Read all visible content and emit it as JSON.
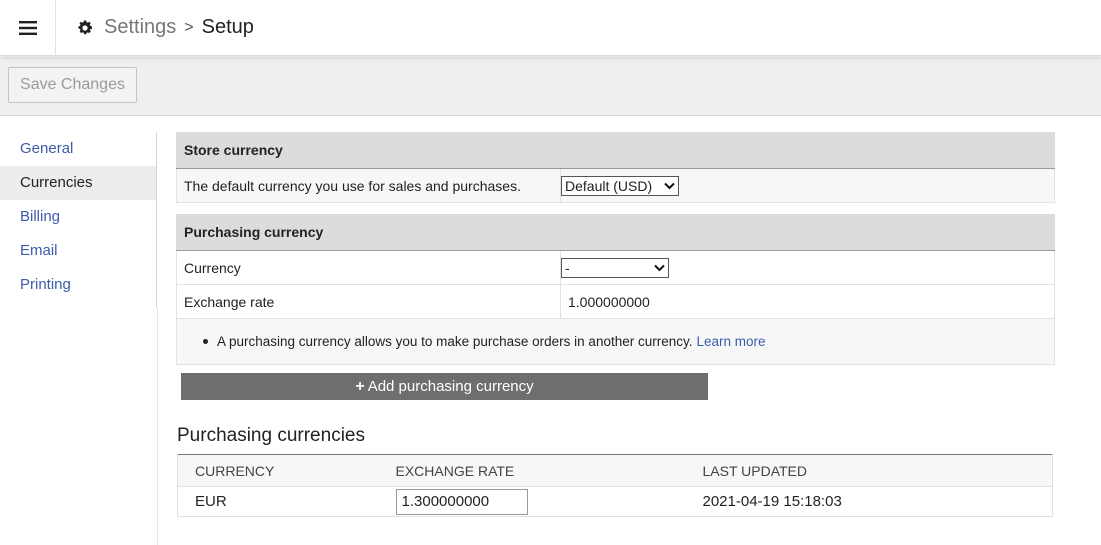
{
  "header": {
    "icon_menu": "hamburger-icon",
    "icon_settings": "gear-icon",
    "breadcrumb_parent": "Settings",
    "breadcrumb_separator": ">",
    "breadcrumb_current": "Setup"
  },
  "toolbar": {
    "save_label": "Save Changes"
  },
  "sidebar": {
    "items": [
      {
        "label": "General",
        "active": false
      },
      {
        "label": "Currencies",
        "active": true
      },
      {
        "label": "Billing",
        "active": false
      },
      {
        "label": "Email",
        "active": false
      },
      {
        "label": "Printing",
        "active": false
      }
    ]
  },
  "store_currency": {
    "heading": "Store currency",
    "description": "The default currency you use for sales and purchases.",
    "selected": "Default (USD)"
  },
  "purchasing_currency": {
    "heading": "Purchasing currency",
    "currency_label": "Currency",
    "currency_selected": "-",
    "exchange_rate_label": "Exchange rate",
    "exchange_rate_value": "1.000000000",
    "note": "A purchasing currency allows you to make purchase orders in another currency.",
    "note_link": "Learn more",
    "add_button": "Add purchasing currency",
    "add_icon": "+"
  },
  "purchasing_currencies": {
    "title": "Purchasing currencies",
    "columns": [
      "CURRENCY",
      "EXCHANGE RATE",
      "LAST UPDATED"
    ],
    "rows": [
      {
        "currency": "EUR",
        "exchange_rate": "1.300000000",
        "last_updated": "2021-04-19 15:18:03"
      }
    ]
  },
  "colors": {
    "link": "#3b5bab",
    "section_header": "#dcdcdc",
    "add_button": "#6e6e6e"
  }
}
